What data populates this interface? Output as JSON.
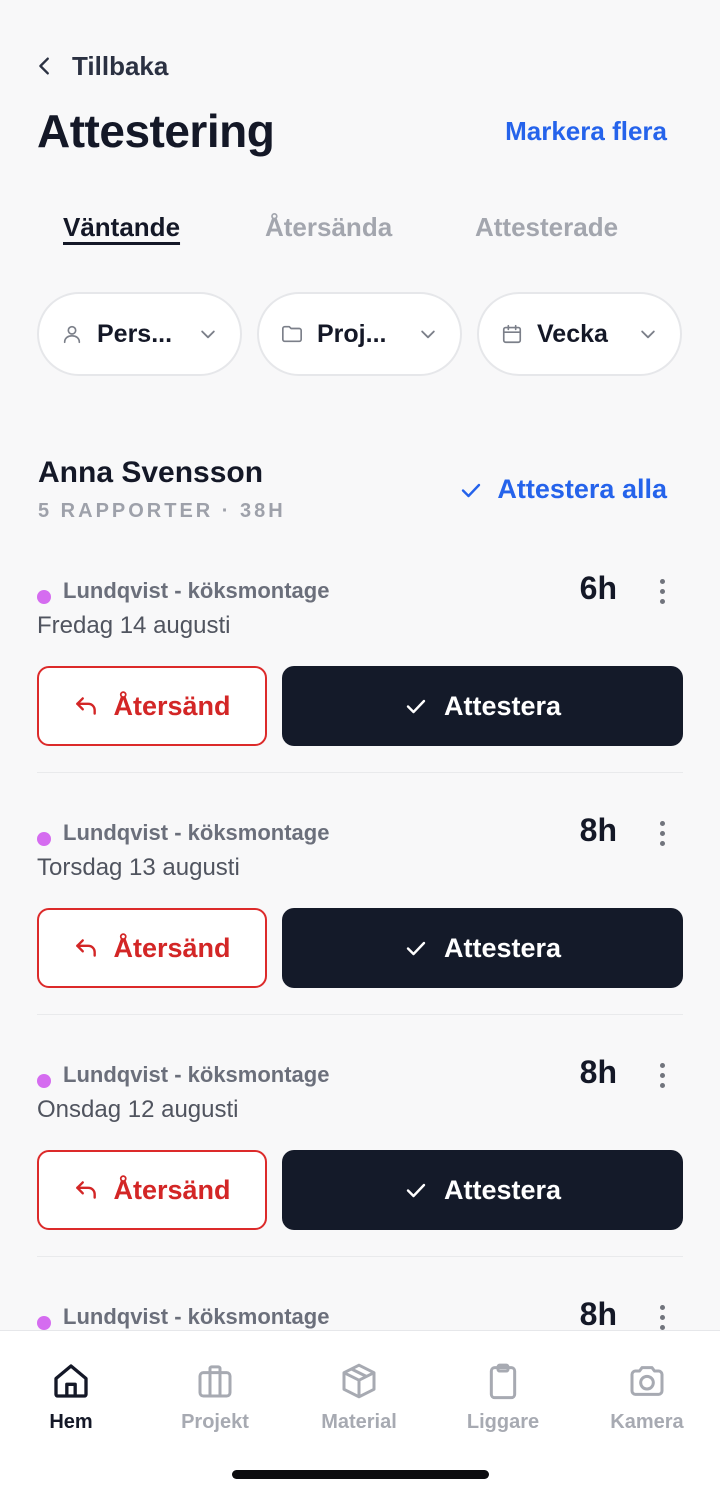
{
  "header": {
    "back_label": "Tillbaka",
    "title": "Attestering",
    "action_label": "Markera flera"
  },
  "tabs": [
    {
      "label": "Väntande",
      "active": true
    },
    {
      "label": "Återsända",
      "active": false
    },
    {
      "label": "Attesterade",
      "active": false
    }
  ],
  "filters": [
    {
      "icon": "person-icon",
      "label": "Pers..."
    },
    {
      "icon": "folder-icon",
      "label": "Proj..."
    },
    {
      "icon": "calendar-icon",
      "label": "Vecka"
    }
  ],
  "group": {
    "person_name": "Anna Svensson",
    "summary": "5 RAPPORTER · 38H",
    "approve_all_label": "Attestera alla"
  },
  "reports": [
    {
      "project": "Lundqvist - köksmontage",
      "date": "Fredag 14 augusti",
      "hours": "6h",
      "return_label": "Återsänd",
      "approve_label": "Attestera"
    },
    {
      "project": "Lundqvist - köksmontage",
      "date": "Torsdag 13 augusti",
      "hours": "8h",
      "return_label": "Återsänd",
      "approve_label": "Attestera"
    },
    {
      "project": "Lundqvist - köksmontage",
      "date": "Onsdag 12 augusti",
      "hours": "8h",
      "return_label": "Återsänd",
      "approve_label": "Attestera"
    },
    {
      "project": "Lundqvist - köksmontage",
      "hours": "8h"
    }
  ],
  "bottom_nav": [
    {
      "icon": "home-icon",
      "label": "Hem",
      "active": true
    },
    {
      "icon": "briefcase-icon",
      "label": "Projekt",
      "active": false
    },
    {
      "icon": "box-icon",
      "label": "Material",
      "active": false
    },
    {
      "icon": "clipboard-icon",
      "label": "Liggare",
      "active": false
    },
    {
      "icon": "camera-icon",
      "label": "Kamera",
      "active": false
    }
  ],
  "colors": {
    "accent": "#2563eb",
    "danger": "#dc2a2a",
    "primary_button": "#141a29",
    "project_dot": "#d56cf0"
  }
}
